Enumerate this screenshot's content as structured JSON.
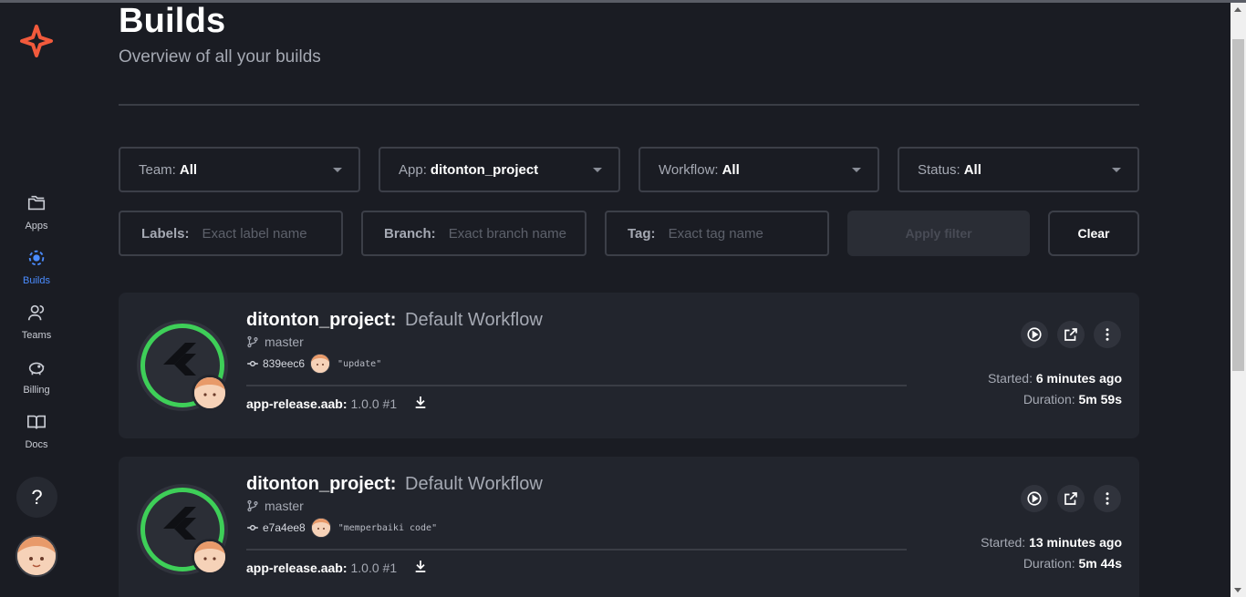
{
  "header": {
    "title": "Builds",
    "subtitle": "Overview of all your builds"
  },
  "sidebar": {
    "items": [
      {
        "label": "Apps",
        "icon": "apps-folder-icon",
        "active": false
      },
      {
        "label": "Builds",
        "icon": "builds-icon",
        "active": true
      },
      {
        "label": "Teams",
        "icon": "teams-icon",
        "active": false
      },
      {
        "label": "Billing",
        "icon": "piggy-bank-icon",
        "active": false
      },
      {
        "label": "Docs",
        "icon": "book-icon",
        "active": false
      }
    ],
    "help_label": "?"
  },
  "filters": {
    "team": {
      "key": "Team:",
      "value": "All"
    },
    "app": {
      "key": "App:",
      "value": "ditonton_project"
    },
    "workflow": {
      "key": "Workflow:",
      "value": "All"
    },
    "status": {
      "key": "Status:",
      "value": "All"
    },
    "labels": {
      "key": "Labels:",
      "placeholder": "Exact label name"
    },
    "branch": {
      "key": "Branch:",
      "placeholder": "Exact branch name"
    },
    "tag": {
      "key": "Tag:",
      "placeholder": "Exact tag name"
    },
    "apply_label": "Apply filter",
    "clear_label": "Clear"
  },
  "builds": [
    {
      "app": "ditonton_project:",
      "workflow": "Default Workflow",
      "branch": "master",
      "commit": "839eec6",
      "message": "\"update\"",
      "artifact_name": "app-release.aab:",
      "artifact_version": "1.0.0 #1",
      "started_label": "Started:",
      "started": "6 minutes ago",
      "duration_label": "Duration:",
      "duration": "5m 59s"
    },
    {
      "app": "ditonton_project:",
      "workflow": "Default Workflow",
      "branch": "master",
      "commit": "e7a4ee8",
      "message": "\"memperbaiki code\"",
      "artifact_name": "app-release.aab:",
      "artifact_version": "1.0.0 #1",
      "started_label": "Started:",
      "started": "13 minutes ago",
      "duration_label": "Duration:",
      "duration": "5m 44s"
    }
  ],
  "colors": {
    "background": "#1a1c23",
    "card": "#22252d",
    "accent": "#4b8cff",
    "success_ring": "#3ecf58"
  }
}
